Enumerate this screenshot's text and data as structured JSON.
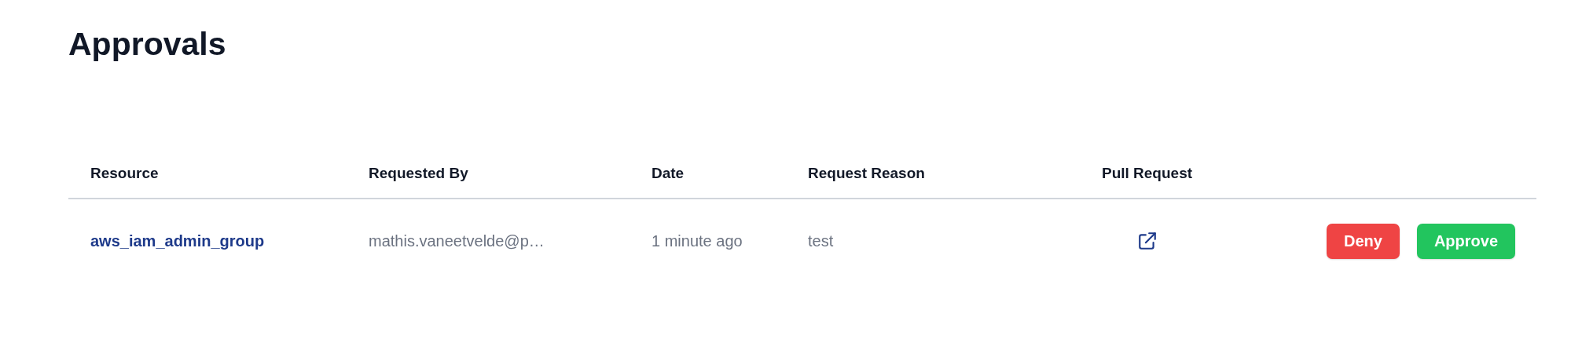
{
  "title": "Approvals",
  "table": {
    "columns": [
      "Resource",
      "Requested By",
      "Date",
      "Request Reason",
      "Pull Request"
    ],
    "rows": [
      {
        "resource": "aws_iam_admin_group",
        "requested_by": "mathis.vaneetvelde@p…",
        "date": "1 minute ago",
        "reason": "test",
        "actions": [
          {
            "kind": "deny",
            "label": "Deny"
          },
          {
            "kind": "approve",
            "label": "Approve"
          }
        ]
      }
    ]
  }
}
